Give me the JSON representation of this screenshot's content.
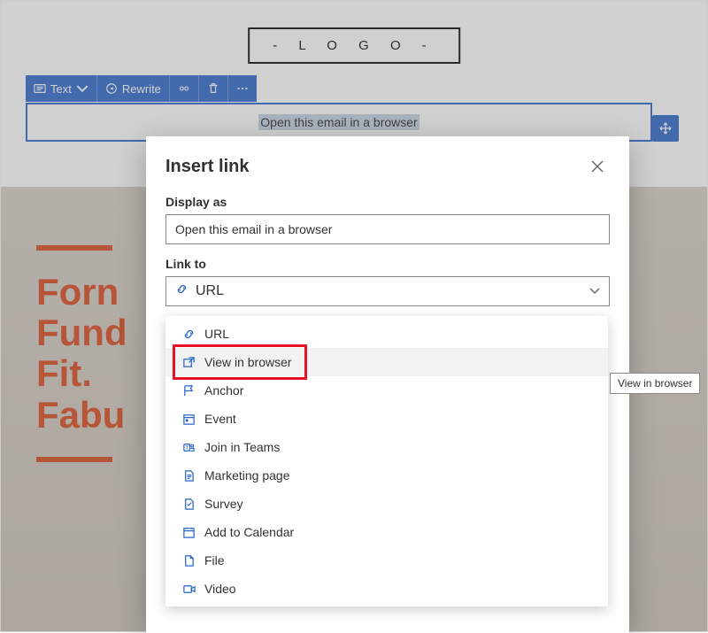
{
  "canvas": {
    "logo_text": "- L O G O -",
    "toolbar": {
      "text_label": "Text",
      "rewrite_label": "Rewrite"
    },
    "edit_text": "Open this email in a browser",
    "hero_lines": [
      "Forn",
      "Fund",
      "Fit.",
      "Fabu"
    ]
  },
  "dialog": {
    "title": "Insert link",
    "display_as_label": "Display as",
    "display_as_value": "Open this email in a browser",
    "link_to_label": "Link to",
    "link_to_selected": "URL",
    "options": [
      {
        "name": "url",
        "label": "URL",
        "icon": "link"
      },
      {
        "name": "view-in-browser",
        "label": "View in browser",
        "icon": "open"
      },
      {
        "name": "anchor",
        "label": "Anchor",
        "icon": "flag"
      },
      {
        "name": "event",
        "label": "Event",
        "icon": "calendar-day"
      },
      {
        "name": "join-in-teams",
        "label": "Join in Teams",
        "icon": "teams"
      },
      {
        "name": "marketing-page",
        "label": "Marketing page",
        "icon": "page"
      },
      {
        "name": "survey",
        "label": "Survey",
        "icon": "survey"
      },
      {
        "name": "add-to-calendar",
        "label": "Add to Calendar",
        "icon": "calendar"
      },
      {
        "name": "file",
        "label": "File",
        "icon": "file"
      },
      {
        "name": "video",
        "label": "Video",
        "icon": "video"
      }
    ]
  },
  "tooltip": "View in browser"
}
